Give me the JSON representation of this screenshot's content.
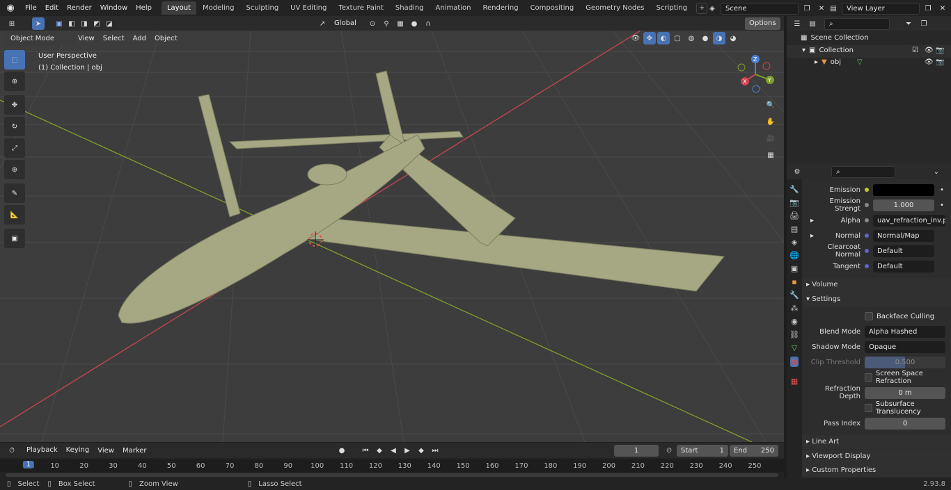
{
  "menu": [
    "File",
    "Edit",
    "Render",
    "Window",
    "Help"
  ],
  "workspace_tabs": [
    {
      "label": "Layout",
      "active": true
    },
    {
      "label": "Modeling"
    },
    {
      "label": "Sculpting"
    },
    {
      "label": "UV Editing"
    },
    {
      "label": "Texture Paint"
    },
    {
      "label": "Shading"
    },
    {
      "label": "Animation"
    },
    {
      "label": "Rendering"
    },
    {
      "label": "Compositing"
    },
    {
      "label": "Geometry Nodes"
    },
    {
      "label": "Scripting"
    }
  ],
  "scene": "Scene",
  "view_layer": "View Layer",
  "viewport_header": {
    "mode": "Object Mode",
    "menus": [
      "View",
      "Select",
      "Add",
      "Object"
    ],
    "transform": "Global",
    "options": "Options"
  },
  "viewport": {
    "perspective": "User Perspective",
    "collection": "(1) Collection | obj",
    "gizmo": {
      "z": "Z",
      "y": "Y",
      "x": "X"
    }
  },
  "outliner": {
    "root": "Scene Collection",
    "collection": "Collection",
    "object": "obj"
  },
  "properties": {
    "emission_label": "Emission",
    "emission_color": "#000000",
    "strength_label": "Emission Strengt",
    "strength_value": "1.000",
    "alpha_label": "Alpha",
    "alpha_value": "uav_refraction_inv.p...",
    "normal_label": "Normal",
    "normal_value": "Normal/Map",
    "clearcoat_label": "Clearcoat Normal",
    "clearcoat_value": "Default",
    "tangent_label": "Tangent",
    "tangent_value": "Default",
    "volume": "Volume",
    "settings": "Settings",
    "backface": "Backface Culling",
    "blend_label": "Blend Mode",
    "blend_value": "Alpha Hashed",
    "shadow_label": "Shadow Mode",
    "shadow_value": "Opaque",
    "clip_label": "Clip Threshold",
    "clip_value": "0.500",
    "clip_fraction": 0.5,
    "ssr": "Screen Space Refraction",
    "refr_label": "Refraction Depth",
    "refr_value": "0 m",
    "subsurface": "Subsurface Translucency",
    "pass_label": "Pass Index",
    "pass_value": "0",
    "lineart": "Line Art",
    "viewport_display": "Viewport Display",
    "custom_props": "Custom Properties"
  },
  "timeline": {
    "menus": [
      "Playback",
      "Keying",
      "View",
      "Marker"
    ],
    "current_frame": "1",
    "start_label": "Start",
    "start": "1",
    "end_label": "End",
    "end": "250",
    "ticks": [
      "1",
      "10",
      "20",
      "30",
      "40",
      "50",
      "60",
      "70",
      "80",
      "90",
      "100",
      "110",
      "120",
      "130",
      "140",
      "150",
      "160",
      "170",
      "180",
      "190",
      "200",
      "210",
      "220",
      "230",
      "240",
      "250"
    ]
  },
  "status": {
    "select": "Select",
    "box_select": "Box Select",
    "zoom": "Zoom View",
    "lasso": "Lasso Select",
    "version": "2.93.8"
  },
  "colors": {
    "accent": "#4772b3",
    "model": "#a6a884",
    "x_axis": "#c94450",
    "y_axis": "#7fa02a"
  }
}
